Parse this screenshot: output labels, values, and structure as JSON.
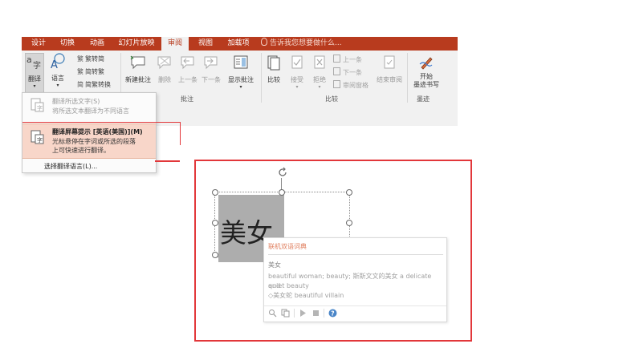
{
  "ribbon": {
    "tabs": [
      {
        "label": "设计"
      },
      {
        "label": "切换"
      },
      {
        "label": "动画"
      },
      {
        "label": "幻灯片放映"
      },
      {
        "label": "审阅",
        "active": true
      },
      {
        "label": "视图"
      },
      {
        "label": "加载项"
      }
    ],
    "tell_me": "告诉我您想要做什么...",
    "translate": "翻译",
    "language": "语言",
    "trad_simp": "繁转简",
    "simp_trad": "简转繁",
    "conv": "简繁转换",
    "new_comment": "新建批注",
    "delete": "删除",
    "previous": "上一条",
    "next": "下一条",
    "show_comments": "显示批注",
    "compare": "比较",
    "accept": "接受",
    "reject": "拒绝",
    "prev_small": "上一条",
    "next_small": "下一条",
    "review_pane": "审阅窗格",
    "end_review": "结束审阅",
    "start_ink": "开始",
    "start_ink2": "墨迹书写",
    "groups": {
      "comments": "批注",
      "compare": "比较",
      "ink": "墨迹"
    },
    "accent_color": "#b83b1e"
  },
  "menu": {
    "item1_title": "翻译所选文字(S)",
    "item1_desc": "将所选文本翻译为不同语言",
    "item2_title": "翻译屏幕提示 [英语(美国)](M)",
    "item2_desc1": "光标悬停在字词或所选的段落",
    "item2_desc2": "上可快速进行翻译。",
    "item3_title": "选择翻译语言(L)...",
    "highlight_color": "#f8d6c9",
    "callout_color": "#e2373a"
  },
  "slide": {
    "text": "美女"
  },
  "dict": {
    "header": "联机双语词典",
    "word": "美女",
    "def1": "beautiful woman; beauty; 斯斯文文的美女 a delicate and",
    "def2": "quiet beauty",
    "def3": "◇美女蛇 beautiful villain"
  }
}
